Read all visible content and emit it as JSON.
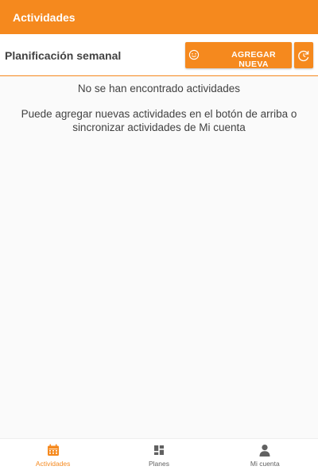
{
  "app_bar": {
    "title": "Actividades"
  },
  "toolbar": {
    "section_title": "Planificación semanal",
    "add_button_label": "AGREGAR NUEVA",
    "add_button_icon": "smiley-icon",
    "sync_button_icon": "sync-icon"
  },
  "empty_state": {
    "title": "No se han encontrado actividades",
    "description": "Puede agregar nuevas actividades en el botón de arriba o sincronizar actividades de Mi cuenta"
  },
  "bottom_nav": {
    "items": [
      {
        "label": "Actividades",
        "icon": "calendar-icon",
        "active": true
      },
      {
        "label": "Planes",
        "icon": "dashboard-icon",
        "active": false
      },
      {
        "label": "Mi cuenta",
        "icon": "person-icon",
        "active": false
      }
    ]
  },
  "colors": {
    "accent": "#f5891e",
    "text": "#424242",
    "background": "#fafafa"
  }
}
